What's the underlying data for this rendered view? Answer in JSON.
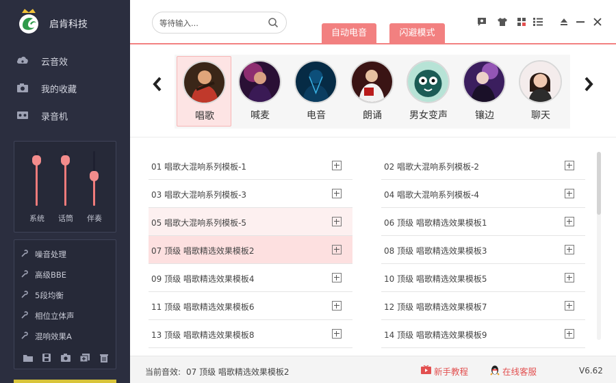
{
  "app": {
    "brand_name": "启肯科技",
    "version": "V6.62"
  },
  "sidebar": {
    "nav": [
      {
        "label": "云音效",
        "icon": "cloud-music-icon"
      },
      {
        "label": "我的收藏",
        "icon": "camera-icon"
      },
      {
        "label": "录音机",
        "icon": "recorder-icon"
      }
    ],
    "sliders": [
      {
        "label": "系统",
        "level": 0.9
      },
      {
        "label": "话筒",
        "level": 0.9
      },
      {
        "label": "伴奏",
        "level": 0.6
      }
    ],
    "effects": [
      {
        "label": "噪音处理",
        "icon": "wrench-icon"
      },
      {
        "label": "高级BBE",
        "icon": "wrench-icon"
      },
      {
        "label": "5段均衡",
        "icon": "wrench-icon"
      },
      {
        "label": "相位立体声",
        "icon": "wrench-icon"
      },
      {
        "label": "混响效果A",
        "icon": "wrench-icon"
      }
    ],
    "tools": [
      "open-folder-icon",
      "save-icon",
      "camera-icon",
      "add-copy-icon",
      "delete-icon"
    ]
  },
  "topbar": {
    "search_placeholder": "等待输入...",
    "mode_tabs": [
      "自动电音",
      "闪避模式"
    ],
    "window_icons": [
      "skin-chat-icon",
      "shirt-icon",
      "grid-view-icon",
      "list-view-icon",
      "eject-icon",
      "minimize-icon",
      "close-icon"
    ]
  },
  "categories": [
    {
      "label": "唱歌",
      "active": true
    },
    {
      "label": "喊麦",
      "active": false
    },
    {
      "label": "电音",
      "active": false
    },
    {
      "label": "朗诵",
      "active": false
    },
    {
      "label": "男女变声",
      "active": false
    },
    {
      "label": "镶边",
      "active": false
    },
    {
      "label": "聊天",
      "active": false
    }
  ],
  "templates": {
    "left": [
      {
        "label": "01 唱歌大混响系列模板-1",
        "highlight": "none"
      },
      {
        "label": "03 唱歌大混响系列模板-3",
        "highlight": "none"
      },
      {
        "label": "05 唱歌大混响系列模板-5",
        "highlight": "light"
      },
      {
        "label": "07 顶级 唱歌精选效果模板2",
        "highlight": "strong"
      },
      {
        "label": "09 顶级 唱歌精选效果模板4",
        "highlight": "none"
      },
      {
        "label": "11 顶级 唱歌精选效果模板6",
        "highlight": "none"
      },
      {
        "label": "13 顶级 唱歌精选效果模板8",
        "highlight": "none"
      }
    ],
    "right": [
      {
        "label": "02 唱歌大混响系列模板-2",
        "highlight": "none"
      },
      {
        "label": "04 唱歌大混响系列模板-4",
        "highlight": "none"
      },
      {
        "label": "06 顶级 唱歌精选效果模板1",
        "highlight": "none"
      },
      {
        "label": "08 顶级 唱歌精选效果模板3",
        "highlight": "none"
      },
      {
        "label": "10 顶级 唱歌精选效果模板5",
        "highlight": "none"
      },
      {
        "label": "12 顶级 唱歌精选效果模板7",
        "highlight": "none"
      },
      {
        "label": "14 顶级 唱歌精选效果模板9",
        "highlight": "none"
      }
    ],
    "scroll_position": 0
  },
  "statusbar": {
    "prefix": "当前音效:",
    "current_effect": "07 顶级 唱歌精选效果模板2",
    "tutorial_label": "新手教程",
    "support_label": "在线客服"
  },
  "colors": {
    "accent": "#f28080",
    "sidebar_bg": "#2b2e3f",
    "link": "#e25050"
  }
}
